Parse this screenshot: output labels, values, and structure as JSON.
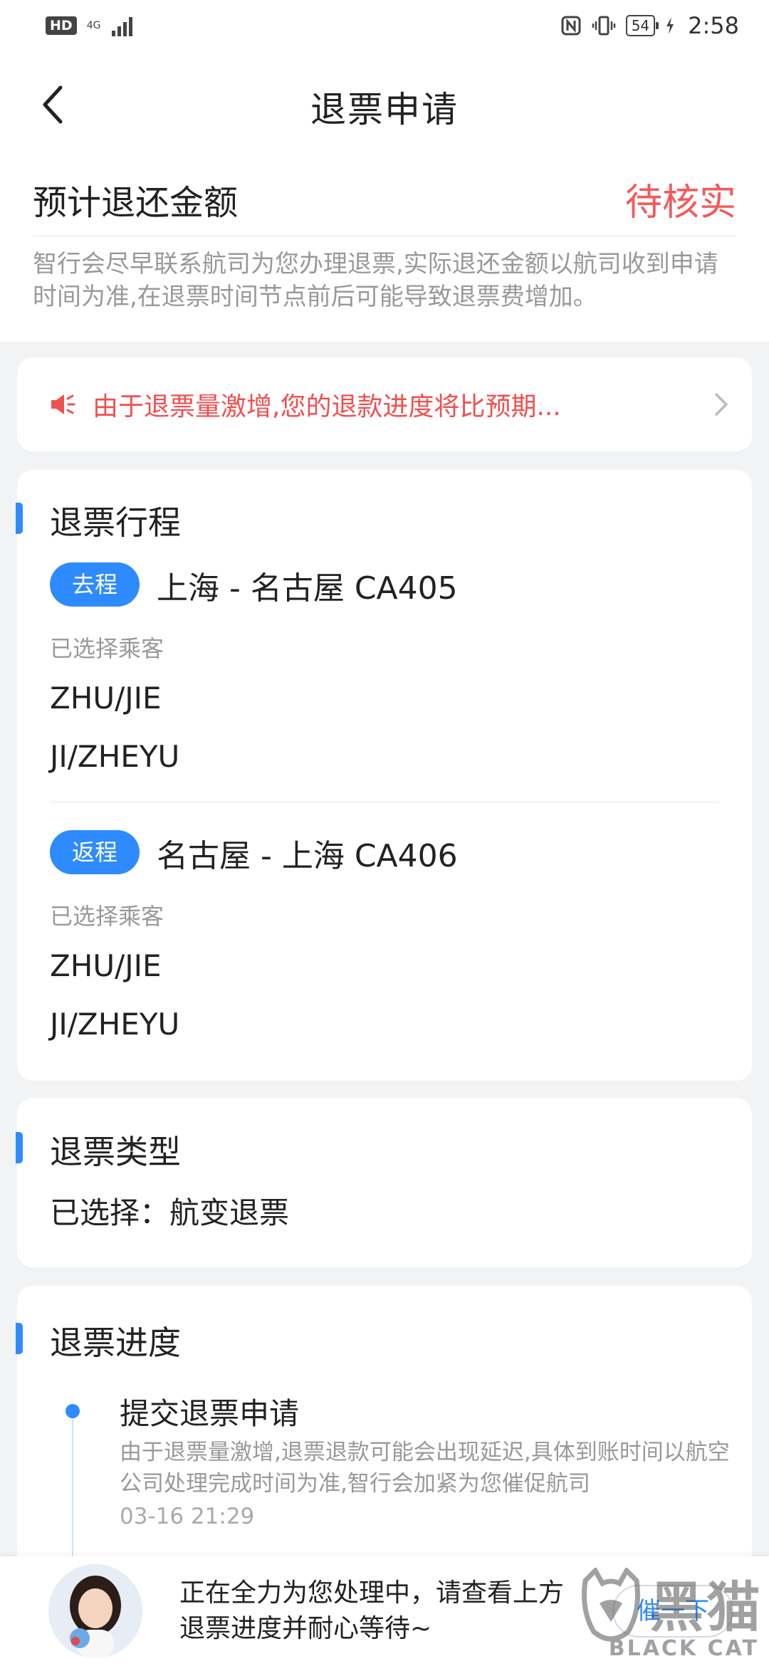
{
  "status_bar": {
    "hd": "HD",
    "network": "4G",
    "battery": "54",
    "time": "2:58"
  },
  "header": {
    "title": "退票申请",
    "back_icon": "chevron-left-icon"
  },
  "summary": {
    "label": "预计退还金额",
    "status": "待核实",
    "note": "智行会尽早联系航司为您办理退票,实际退还金额以航司收到申请时间为准,在退票时间节点前后可能导致退票费增加。"
  },
  "notice": {
    "icon": "speaker-icon",
    "text": "由于退票量激增,您的退款进度将比预期...",
    "arrow_icon": "chevron-right-icon"
  },
  "itinerary": {
    "title": "退票行程",
    "trips": [
      {
        "tag": "去程",
        "route": "上海 - 名古屋 CA405",
        "passengers_label": "已选择乘客",
        "passengers": [
          "ZHU/JIE",
          "JI/ZHEYU"
        ]
      },
      {
        "tag": "返程",
        "route": "名古屋 - 上海 CA406",
        "passengers_label": "已选择乘客",
        "passengers": [
          "ZHU/JIE",
          "JI/ZHEYU"
        ]
      }
    ]
  },
  "refund_type": {
    "title": "退票类型",
    "value": "已选择：航变退票"
  },
  "progress": {
    "title": "退票进度",
    "steps": [
      {
        "title": "提交退票申请",
        "desc": "由于退票量激增,退票退款可能会出现延迟,具体到账时间以航空公司处理完成时间为准,智行会加紧为您催促航司",
        "time": "03-16 21:29"
      }
    ]
  },
  "bottom_bar": {
    "message": "正在全力为您处理中，请查看上方退票进度并耐心等待~",
    "button": "催一下"
  },
  "watermark": {
    "cn": "黑猫",
    "en": "BLACK CAT"
  },
  "colors": {
    "accent": "#2e8bff",
    "warning": "#f0504f",
    "background": "#f2f3f5"
  }
}
